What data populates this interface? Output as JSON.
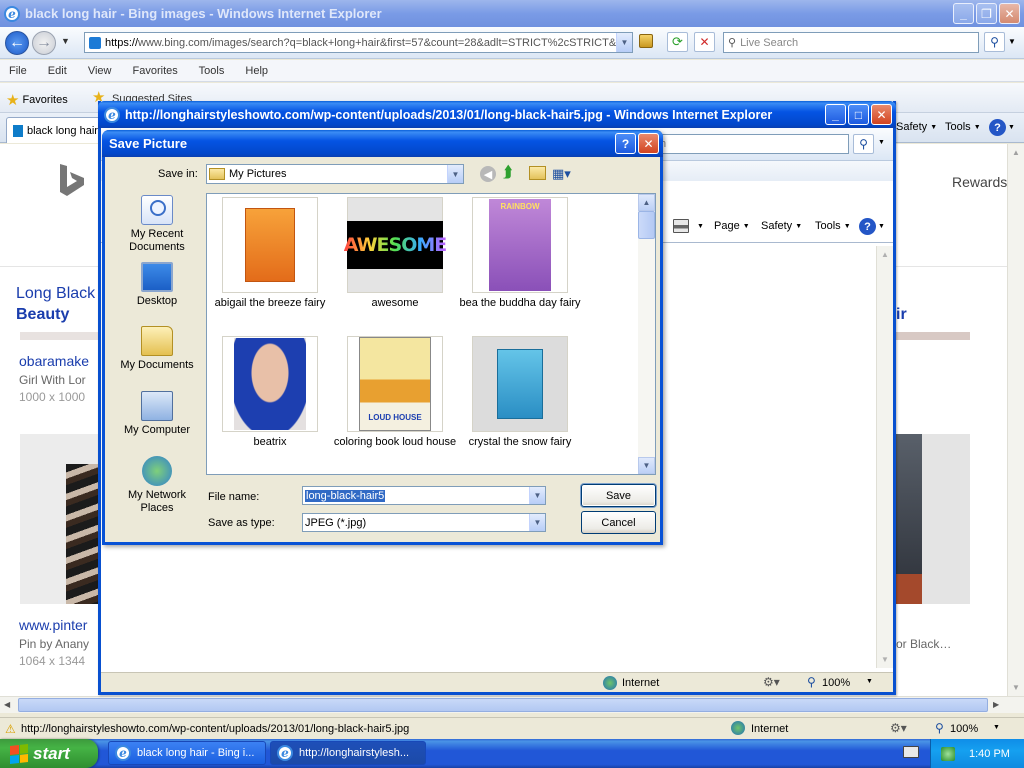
{
  "main_window": {
    "title": "black long hair - Bing images - Windows Internet Explorer",
    "address_prefix": "https://",
    "address_rest": "www.bing.com/images/search?q=black+long+hair&first=57&count=28&adlt=STRICT%2cSTRICT&",
    "search_placeholder": "Live Search",
    "menu": [
      "File",
      "Edit",
      "View",
      "Favorites",
      "Tools",
      "Help"
    ],
    "favorites_label": "Favorites",
    "suggested_sites_label": "Suggested Sites",
    "tab_label": "black long hair",
    "cmd_safety": "Safety",
    "cmd_tools": "Tools",
    "rewards_label": "Rewards",
    "results": {
      "heading_line1": "Long Black",
      "heading_line2": "Beauty",
      "right_heading": "ir",
      "result1_site": "obaramake",
      "result1_desc": "Girl With Lor",
      "result1_size": "1000 x 1000",
      "result2_site": "www.pinter",
      "result2_desc": "Pin by Anany",
      "result2_size": "1064 x 1344",
      "right_result_desc": "or Black…"
    },
    "status_url": "http://longhairstyleshowto.com/wp-content/uploads/2013/01/long-black-hair5.jpg",
    "status_zone": "Internet",
    "status_zoom": "100%"
  },
  "popup_window": {
    "title": "http://longhairstyleshowto.com/wp-content/uploads/2013/01/long-black-hair5.jpg - Windows Internet Explorer",
    "cmd_page": "Page",
    "cmd_safety": "Safety",
    "cmd_tools": "Tools",
    "search_partial": "h",
    "status_zone": "Internet",
    "status_zoom": "100%"
  },
  "save_dialog": {
    "title": "Save Picture",
    "save_in_label": "Save in:",
    "save_in_value": "My Pictures",
    "places": [
      {
        "label": "My Recent Documents",
        "icon": "recent-documents-icon"
      },
      {
        "label": "Desktop",
        "icon": "desktop-icon"
      },
      {
        "label": "My Documents",
        "icon": "my-documents-icon"
      },
      {
        "label": "My Computer",
        "icon": "my-computer-icon"
      },
      {
        "label": "My Network Places",
        "icon": "network-places-icon"
      }
    ],
    "files": [
      {
        "name": "abigail the breeze fairy"
      },
      {
        "name": "awesome",
        "thumb_text": "AWESOME"
      },
      {
        "name": "bea the buddha day fairy",
        "thumb_text": "RAINBOW"
      },
      {
        "name": "beatrix"
      },
      {
        "name": "coloring book loud house",
        "thumb_text": "LOUD HOUSE"
      },
      {
        "name": "crystal the snow fairy"
      }
    ],
    "file_name_label": "File name:",
    "file_name_value": "long-black-hair5",
    "save_type_label": "Save as type:",
    "save_type_value": "JPEG (*.jpg)",
    "save_button": "Save",
    "cancel_button": "Cancel"
  },
  "taskbar": {
    "start_label": "start",
    "items": [
      {
        "label": "black long hair - Bing i..."
      },
      {
        "label": "http://longhairstylesh..."
      }
    ],
    "clock": "1:40 PM"
  }
}
